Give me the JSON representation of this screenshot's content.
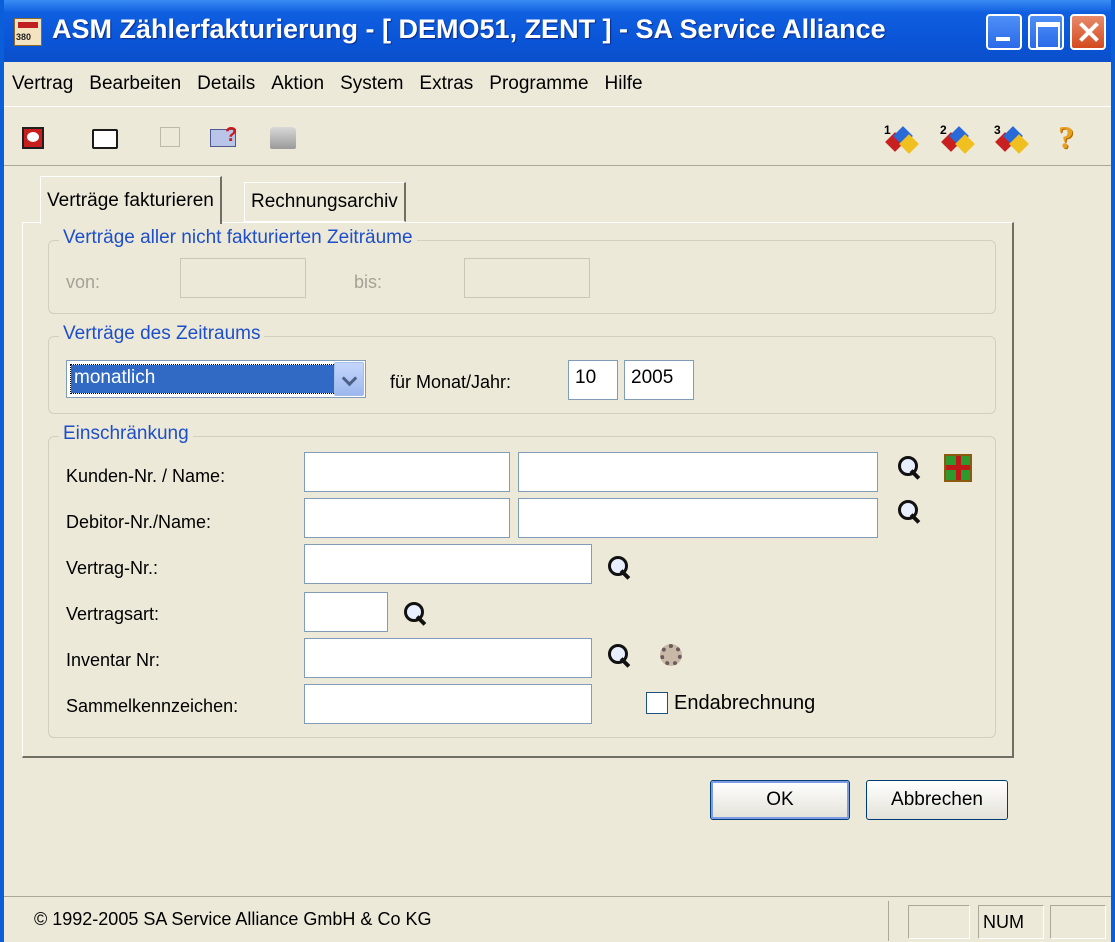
{
  "window": {
    "title": "ASM Zählerfakturierung - [ DEMO51, ZENT ]  - SA Service Alliance"
  },
  "menu": {
    "items": [
      "Vertrag",
      "Bearbeiten",
      "Details",
      "Aktion",
      "System",
      "Extras",
      "Programme",
      "Hilfe"
    ]
  },
  "toolbar": {
    "icons": [
      "calendar-icon",
      "window-icon",
      "blank-icon",
      "help-window-icon",
      "print-icon",
      "navigate-1-icon",
      "navigate-2-icon",
      "navigate-3-icon",
      "help-icon"
    ],
    "nav1_label": "1",
    "nav2_label": "2",
    "nav3_label": "3",
    "help_label": "?"
  },
  "tabs": [
    "Verträge fakturieren",
    "Rechnungsarchiv"
  ],
  "group_unbilled": {
    "title": "Verträge aller nicht fakturierten Zeiträume",
    "from_label": "von:",
    "from_value": "",
    "to_label": "bis:",
    "to_value": ""
  },
  "group_period": {
    "title": "Verträge des Zeitraums",
    "period_value": "monatlich",
    "month_year_label": "für Monat/Jahr:",
    "month": "10",
    "year": "2005"
  },
  "group_filter": {
    "title": "Einschränkung",
    "customer_label": "Kunden-Nr. / Name:",
    "customer_no": "",
    "customer_name": "",
    "debtor_label": "Debitor-Nr./Name:",
    "debtor_no": "",
    "debtor_name": "",
    "contract_label": "Vertrag-Nr.:",
    "contract_no": "",
    "contract_type_label": "Vertragsart:",
    "contract_type": "",
    "inventory_label": "Inventar Nr:",
    "inventory_no": "",
    "collective_label": "Sammelkennzeichen:",
    "collective": "",
    "final_billing_label": "Endabrechnung",
    "final_billing_checked": false
  },
  "buttons": {
    "ok": "OK",
    "cancel": "Abbrechen"
  },
  "status": {
    "text": "© 1992-2005  SA Service Alliance GmbH & Co KG",
    "pane_num": "NUM"
  }
}
